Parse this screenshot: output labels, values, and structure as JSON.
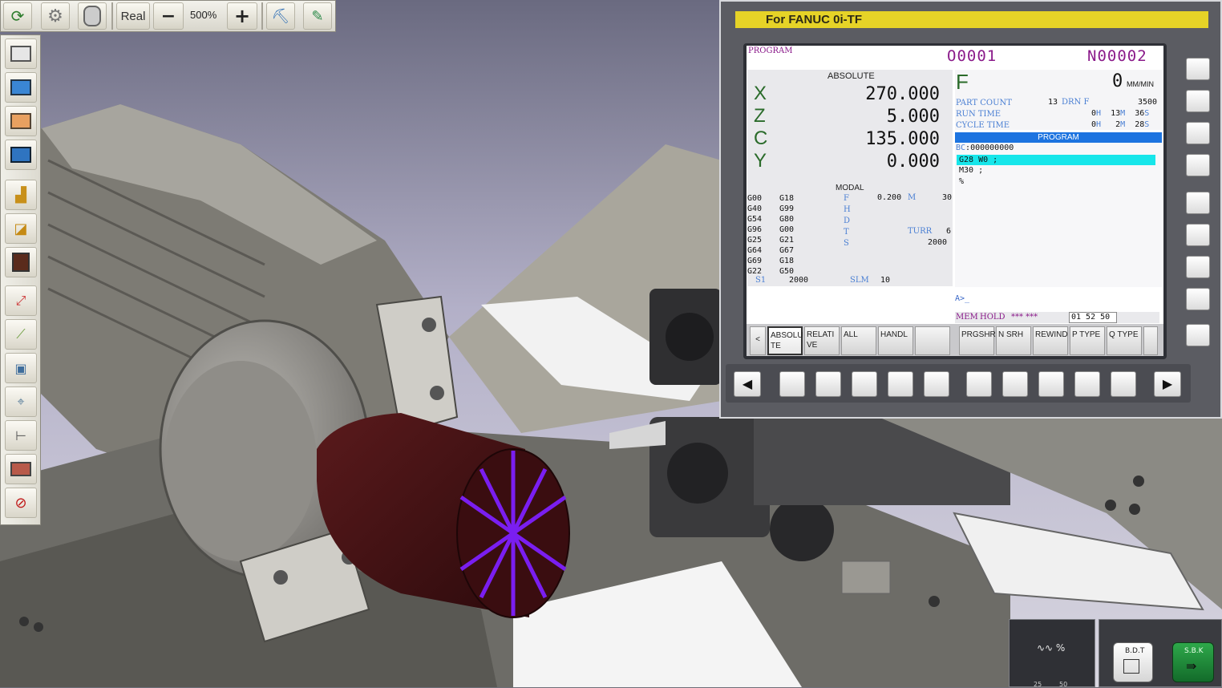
{
  "top_toolbar": {
    "mode_label": "Real",
    "minus_label": "−",
    "zoom": "500%",
    "plus_label": "+"
  },
  "fanuc": {
    "title": "For FANUC 0i-TF",
    "screen_label": "PROGRAM",
    "program_no": "O0001",
    "seq_no": "N00002",
    "absolute": {
      "heading": "ABSOLUTE",
      "axes": [
        {
          "name": "X",
          "value": "270.000"
        },
        {
          "name": "Z",
          "value": "5.000"
        },
        {
          "name": "C",
          "value": "135.000"
        },
        {
          "name": "Y",
          "value": "0.000"
        }
      ]
    },
    "feed": {
      "letter": "F",
      "value": "0",
      "unit": "MM/MIN",
      "part_count_label": "PART COUNT",
      "part_count": "13",
      "drn_label": "DRN F",
      "drn_value": "3500",
      "run_time_label": "RUN TIME",
      "run_h": "0",
      "run_h_u": "H",
      "run_m": "13",
      "run_m_u": "M",
      "run_s": "36",
      "run_s_u": "S",
      "cycle_time_label": "CYCLE TIME",
      "cyc_h": "0",
      "cyc_h_u": "H",
      "cyc_m": "2",
      "cyc_m_u": "M",
      "cyc_s": "28",
      "cyc_s_u": "S"
    },
    "program_panel": {
      "heading": "PROGRAM",
      "line0_prefix": "BC",
      "line0": ":000000000",
      "lines": [
        "G28 W0 ;",
        "M30 ;",
        "%"
      ]
    },
    "modal": {
      "heading": "MODAL",
      "gcodes": [
        [
          "G00",
          "G18"
        ],
        [
          "G40",
          "G99"
        ],
        [
          "G54",
          "G80"
        ],
        [
          "G96",
          "G00"
        ],
        [
          "G25",
          "G21"
        ],
        [
          "G64",
          "G67"
        ],
        [
          "G69",
          "G18"
        ],
        [
          "G22",
          "G50"
        ]
      ],
      "labels": [
        "F",
        "H",
        "D",
        "T",
        "S"
      ],
      "f_value": "0.200",
      "m_label": "M",
      "m_value": "30",
      "turr_label": "TURR",
      "turr_value": "6",
      "s_value": "2000",
      "s1_label": "S1",
      "s1_value": "2000",
      "slm_label": "SLM",
      "slm_value": "10"
    },
    "input_prompt": "A>_",
    "status": {
      "mode": "MEM",
      "state": "HOLD",
      "stars": "*** ***",
      "time": "01 52 50"
    },
    "softkeys_left": [
      "<",
      "ABSOLU\nTE",
      "RELATI\nVE",
      "ALL",
      "HANDL",
      ""
    ],
    "softkeys_right": [
      "PRGSHR",
      "N SRH",
      "REWIND",
      "P TYPE",
      "Q TYPE",
      ""
    ],
    "nav_left": "◀",
    "nav_right": "▶"
  },
  "bottom": {
    "feed_symbol": "∿∿ %",
    "feed_scale_a": "25",
    "feed_scale_b": "50",
    "bdt_label": "B.D.T",
    "sbk_label": "S.B.K"
  }
}
